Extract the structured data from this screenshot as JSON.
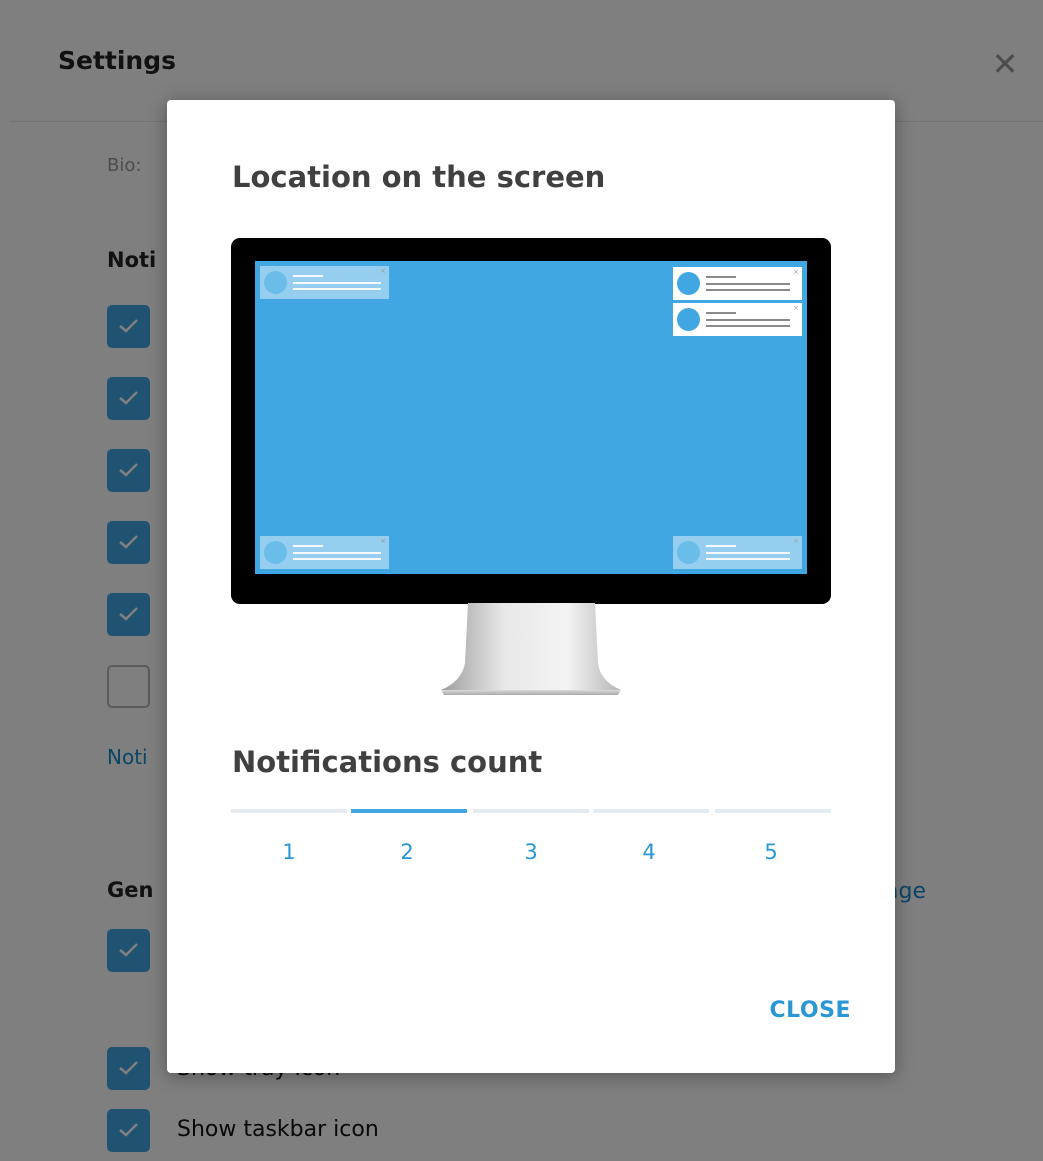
{
  "settings": {
    "title": "Settings",
    "close_glyph": "✕",
    "bio_label": "Bio:",
    "notifications_heading": "Noti",
    "notifications_link": "Noti",
    "general_heading": "Gen",
    "language_link": "age",
    "tray_label": "Show tray icon",
    "taskbar_label": "Show taskbar icon",
    "notification_checkboxes": [
      true,
      true,
      true,
      true,
      true,
      false
    ],
    "general_checkboxes": [
      true,
      true,
      true
    ]
  },
  "dialog": {
    "title": "Location on the screen",
    "count_title": "Notifications count",
    "count_options": [
      "1",
      "2",
      "3",
      "4",
      "5"
    ],
    "selected_count": "2",
    "close_label": "CLOSE"
  },
  "colors": {
    "accent": "#40a7e3",
    "link": "#168acd",
    "overlay": "rgba(0,0,0,0.5)"
  }
}
